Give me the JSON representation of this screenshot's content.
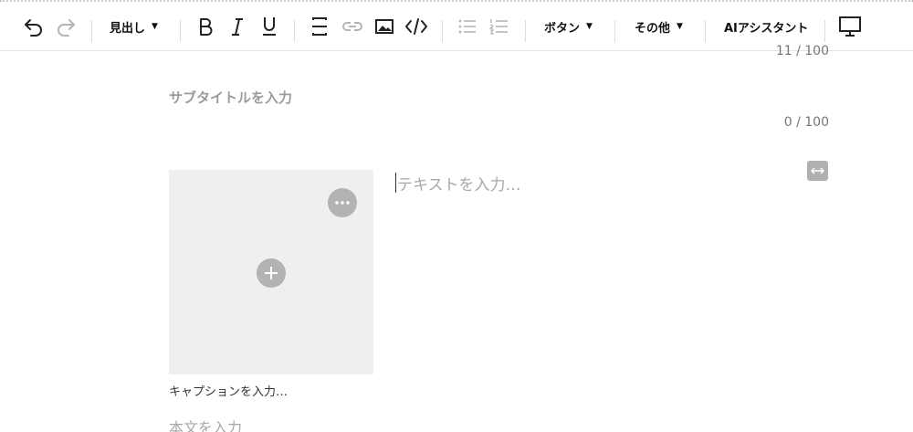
{
  "toolbar": {
    "heading_label": "見出し",
    "button_label": "ボタン",
    "other_label": "その他",
    "ai_label": "AIアシスタント"
  },
  "editor": {
    "title_counter": "11 / 100",
    "subtitle_placeholder": "サブタイトルを入力",
    "subtitle_counter": "0 / 100",
    "text_placeholder": "テキストを入力…",
    "caption_placeholder": "キャプションを入力…",
    "body_placeholder": "本文を入力"
  },
  "icons": {
    "undo": "undo-icon",
    "redo": "redo-icon",
    "bold": "bold-icon",
    "italic": "italic-icon",
    "underline": "underline-icon",
    "strikethrough": "strikethrough-icon",
    "link": "link-icon",
    "image": "image-icon",
    "code": "code-icon",
    "bullet_list": "bullet-list-icon",
    "numbered_list": "numbered-list-icon",
    "preview": "desktop-preview-icon"
  },
  "colors": {
    "toolbar_icon": "#222222",
    "disabled_icon": "#b5b5b5",
    "placeholder": "#a8a8a8",
    "image_bg": "#efefef",
    "round_button": "#b3b3b3"
  }
}
